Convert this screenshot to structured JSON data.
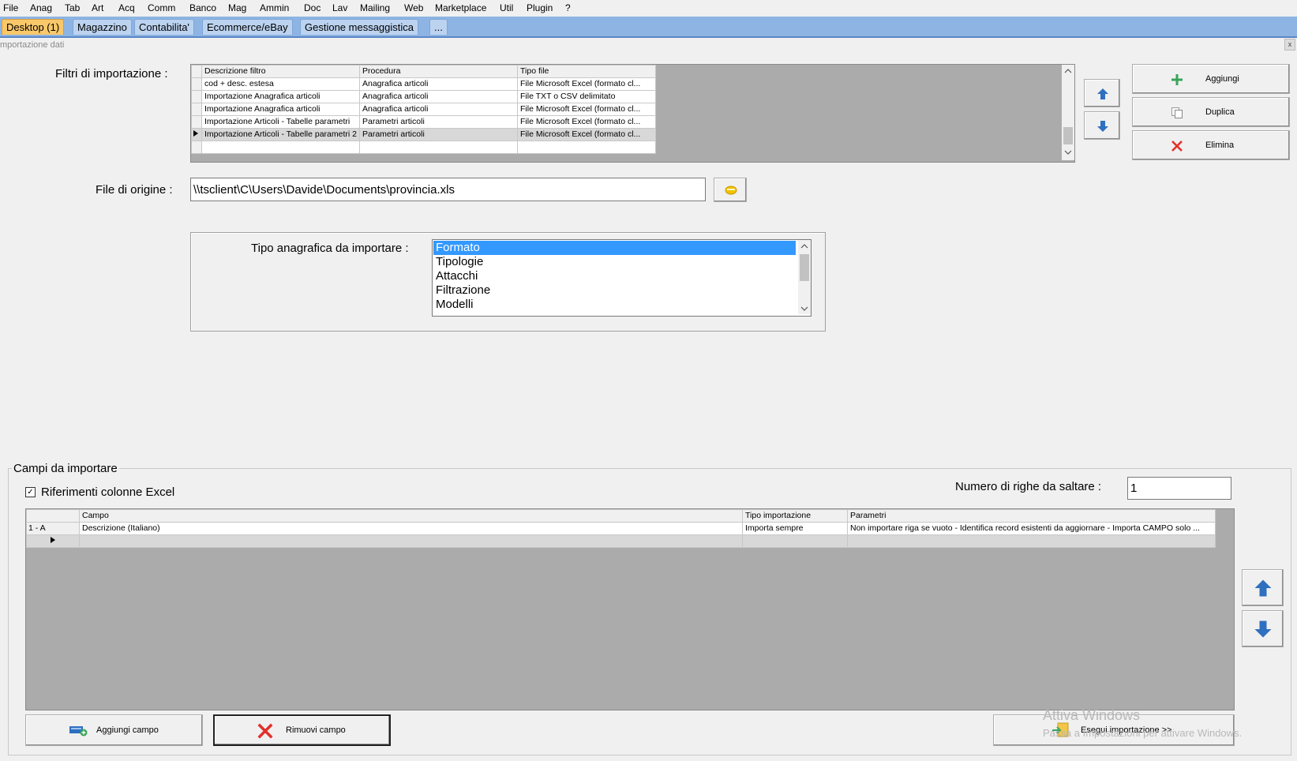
{
  "menu": [
    "File",
    "Anag",
    "Tab",
    "Art",
    "Acq",
    "Comm",
    "Banco",
    "Mag",
    "Ammin",
    "Doc",
    "Lav",
    "Mailing",
    "Web",
    "Marketplace",
    "Util",
    "Plugin",
    "?"
  ],
  "tabs": [
    "Desktop (1)",
    "Magazzino",
    "Contabilita'",
    "Ecommerce/eBay",
    "Gestione messaggistica",
    "..."
  ],
  "window_subtitle": "mportazione dati",
  "close_glyph": "x",
  "filters": {
    "label": "Filtri di importazione :",
    "columns": [
      "Descrizione filtro",
      "Procedura",
      "Tipo file"
    ],
    "rows": [
      [
        "cod + desc. estesa",
        "Anagrafica articoli",
        "File Microsoft Excel (formato cl..."
      ],
      [
        "Importazione Anagrafica articoli",
        "Anagrafica articoli",
        "File TXT o CSV delimitato"
      ],
      [
        "Importazione Anagrafica articoli",
        "Anagrafica articoli",
        "File Microsoft Excel (formato cl..."
      ],
      [
        "Importazione Articoli - Tabelle parametri",
        "Parametri articoli",
        "File Microsoft Excel (formato cl..."
      ],
      [
        "Importazione Articoli - Tabelle parametri 2",
        "Parametri articoli",
        "File Microsoft Excel (formato cl..."
      ]
    ],
    "selected_row": 4
  },
  "actions": {
    "add": "Aggiungi",
    "duplicate": "Duplica",
    "delete": "Elimina"
  },
  "source_file": {
    "label": "File di origine :",
    "value": "\\\\tsclient\\C\\Users\\Davide\\Documents\\provincia.xls"
  },
  "tipo": {
    "label": "Tipo anagrafica da importare :",
    "items": [
      "Formato",
      "Tipologie",
      "Attacchi",
      "Filtrazione",
      "Modelli"
    ],
    "selected": 0
  },
  "fields": {
    "legend": "Campi da importare",
    "checkbox_label": "Riferimenti colonne Excel",
    "checkbox_checked": true,
    "check_glyph": "✓",
    "skip_label": "Numero di righe da saltare  :",
    "skip_value": "1",
    "columns": [
      "Campo",
      "Tipo importazione",
      "Parametri"
    ],
    "rows": [
      [
        "1 - A",
        "Descrizione (Italiano)",
        "Importa sempre",
        "Non importare riga se vuoto - Identifica record esistenti da aggiornare - Importa CAMPO solo ..."
      ]
    ]
  },
  "bottom_buttons": {
    "add_field": "Aggiungi campo",
    "remove_field": "Rimuovi campo",
    "execute": "Esegui importazione >>"
  },
  "watermark": {
    "line1": "Attiva Windows",
    "line2": "Passa a Impostazioni per attivare Windows."
  }
}
